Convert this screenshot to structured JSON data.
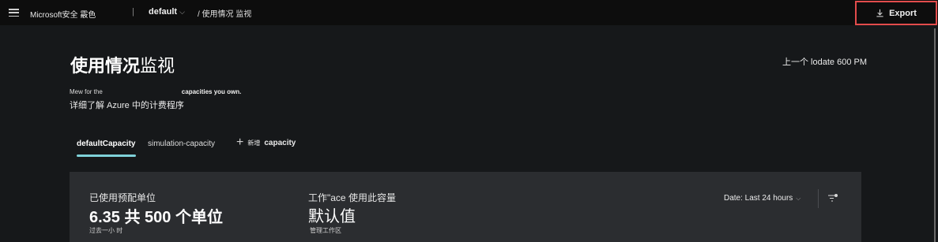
{
  "topbar": {
    "brand": "Microsoft安全 霰色",
    "sep1": "|",
    "workspace": "default",
    "workspace_chevron": "⌵",
    "breadcrumb": "/ 使用情况 监视",
    "export_label": "Export"
  },
  "header": {
    "title_bold": "使用情况",
    "title_normal": "监视",
    "last_update": "上一个 lodate 600 PM",
    "desc_line1_a": "Mew for the",
    "desc_line1_b": "capacities you own.",
    "desc_line2": "详细了解 Azure 中的计费程序"
  },
  "tabs": [
    {
      "label": "defaultCapacity",
      "active": true
    },
    {
      "label": "simulation-capacity",
      "active": false
    }
  ],
  "add_capacity": {
    "prefix": "新增",
    "label": "capacity"
  },
  "card": {
    "label1": "已使用预配单位",
    "value1": "6.35 共 500 个单位",
    "sub1": "过去一小 时",
    "label2": "工作\"ace 使用此容量",
    "value2": "默认值",
    "sub2": "管理工作区",
    "date_filter": "Date: Last 24 hours",
    "date_chevron": "⌵"
  },
  "colors": {
    "accent": "#7fd1d9",
    "export_border": "#e24c4c",
    "background": "#16181a",
    "card": "#2b2d30"
  },
  "icons": [
    "hamburger-icon",
    "download-icon",
    "plus-icon",
    "chevron-down-icon",
    "filter-icon"
  ]
}
